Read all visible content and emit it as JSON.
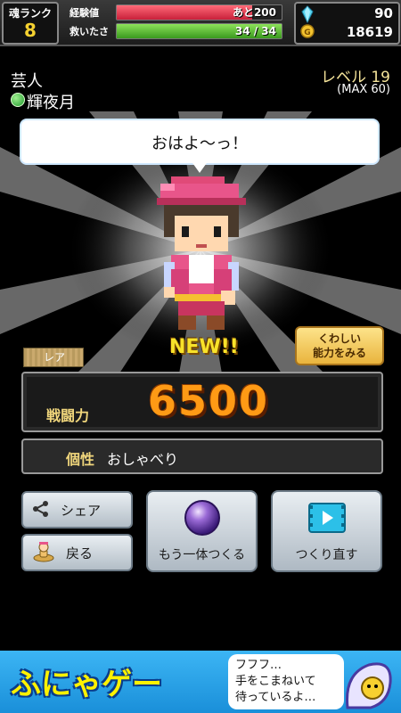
{
  "status": {
    "rank_label": "魂ランク",
    "rank_value": "8",
    "exp_label": "経験値",
    "exp_text": "あと200",
    "exp_fraction": 0.82,
    "rescued_label": "救いたさ",
    "rescued_text": "34 / 34",
    "rescued_fraction": 1.0,
    "gems": "90",
    "coins": "18619"
  },
  "character": {
    "job": "芸人",
    "name": "輝夜月",
    "level": "レベル 19",
    "level_max": "(MAX 60)",
    "speech": "おはよ～っ！",
    "new_label": "NEW!!",
    "rarity": "レア",
    "power_label": "戦闘力",
    "power_value": "6500",
    "trait_label": "個性",
    "trait_value": "おしゃべり"
  },
  "buttons": {
    "detail": "くわしい\n能力をみる",
    "share": "シェア",
    "back": "戻る",
    "create_another": "もう一体つくる",
    "remake": "つくり直す"
  },
  "ad": {
    "title": "ふにゃゲー",
    "bubble": "フフフ…\n手をこまねいて\n待っているよ…"
  },
  "colors": {
    "exp_bar": "#e0384d",
    "rescued_bar": "#4caf2a",
    "power": "#ff9a15",
    "accent_gold": "#f0d67c"
  }
}
